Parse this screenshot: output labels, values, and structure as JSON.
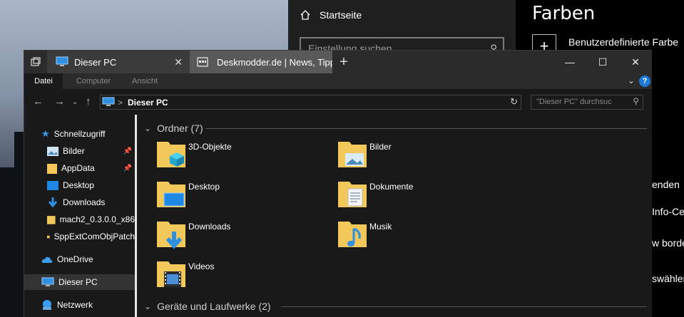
{
  "settings": {
    "home_label": "Startseite",
    "search_placeholder": "Einstellung suchen",
    "page_title": "Farben",
    "custom_color_label": "Benutzerdefinierte Farbe",
    "right_fragments": [
      "enden",
      "Info-Ce",
      "w borde",
      "swählen"
    ]
  },
  "explorer": {
    "tabs": [
      {
        "label": "Dieser PC",
        "close": "✕"
      },
      {
        "label": "Deskmodder.de | News, Tipps"
      }
    ],
    "new_tab": "+",
    "window_controls": {
      "minimize": "—",
      "maximize": "☐",
      "close": "✕"
    },
    "ribbon": {
      "file": "Datei",
      "computer": "Computer",
      "view": "Ansicht",
      "help": "?"
    },
    "address": {
      "crumb": "Dieser PC",
      "separator": ">"
    },
    "search_placeholder": "\"Dieser PC\" durchsuc",
    "nav": {
      "quick_access": "Schnellzugriff",
      "items": [
        {
          "label": "Bilder",
          "icon": "pictures-icon",
          "pinned": true
        },
        {
          "label": "AppData",
          "icon": "folder-icon",
          "pinned": true
        },
        {
          "label": "Desktop",
          "icon": "desktop-icon",
          "pinned": false
        },
        {
          "label": "Downloads",
          "icon": "downloads-icon",
          "pinned": false
        },
        {
          "label": "mach2_0.3.0.0_x86",
          "icon": "folder-icon",
          "pinned": false
        },
        {
          "label": "SppExtComObjPatch",
          "icon": "folder-icon",
          "pinned": false
        }
      ],
      "onedrive": "OneDrive",
      "this_pc": "Dieser PC",
      "network": "Netzwerk"
    },
    "groups": {
      "folders_header": "Ordner (7)",
      "devices_header": "Geräte und Laufwerke (2)"
    },
    "folders": [
      {
        "label": "3D-Objekte",
        "icon": "3d-objects-icon"
      },
      {
        "label": "Bilder",
        "icon": "pictures-icon"
      },
      {
        "label": "Desktop",
        "icon": "desktop-icon"
      },
      {
        "label": "Dokumente",
        "icon": "documents-icon"
      },
      {
        "label": "Downloads",
        "icon": "downloads-icon"
      },
      {
        "label": "Musik",
        "icon": "music-icon"
      },
      {
        "label": "Videos",
        "icon": "videos-icon"
      }
    ]
  },
  "colors": {
    "accent": "#1e78d7",
    "folder_yellow": "#f3c85a",
    "window_bg": "#191919",
    "tab_inactive": "#595959"
  }
}
